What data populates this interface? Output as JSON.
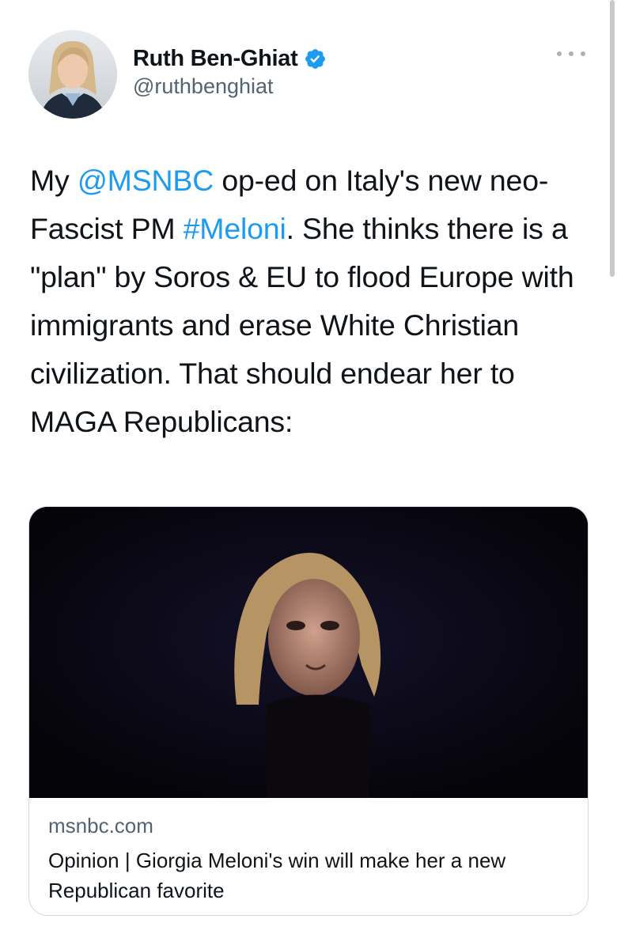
{
  "author": {
    "display_name": "Ruth Ben-Ghiat",
    "handle": "@ruthbenghiat",
    "verified": true,
    "avatar_icon": "profile-photo"
  },
  "tweet": {
    "text_parts": {
      "p1": "My ",
      "mention": "@MSNBC",
      "p2": " op-ed on Italy's new neo-Fascist PM ",
      "hashtag": "#Meloni",
      "p3": ". She thinks there is a \"plan\" by Soros & EU to flood Europe with immigrants and erase White Christian civilization. That should endear her to MAGA Republicans:"
    }
  },
  "link_card": {
    "domain": "msnbc.com",
    "title": "Opinion | Giorgia Meloni's win will make her a new Republican favorite"
  },
  "colors": {
    "link": "#1d9bf0",
    "verified_badge": "#1d9bf0",
    "secondary_text": "#536471"
  },
  "icons": {
    "verified": "verified-badge-icon",
    "more": "more-options-icon"
  }
}
